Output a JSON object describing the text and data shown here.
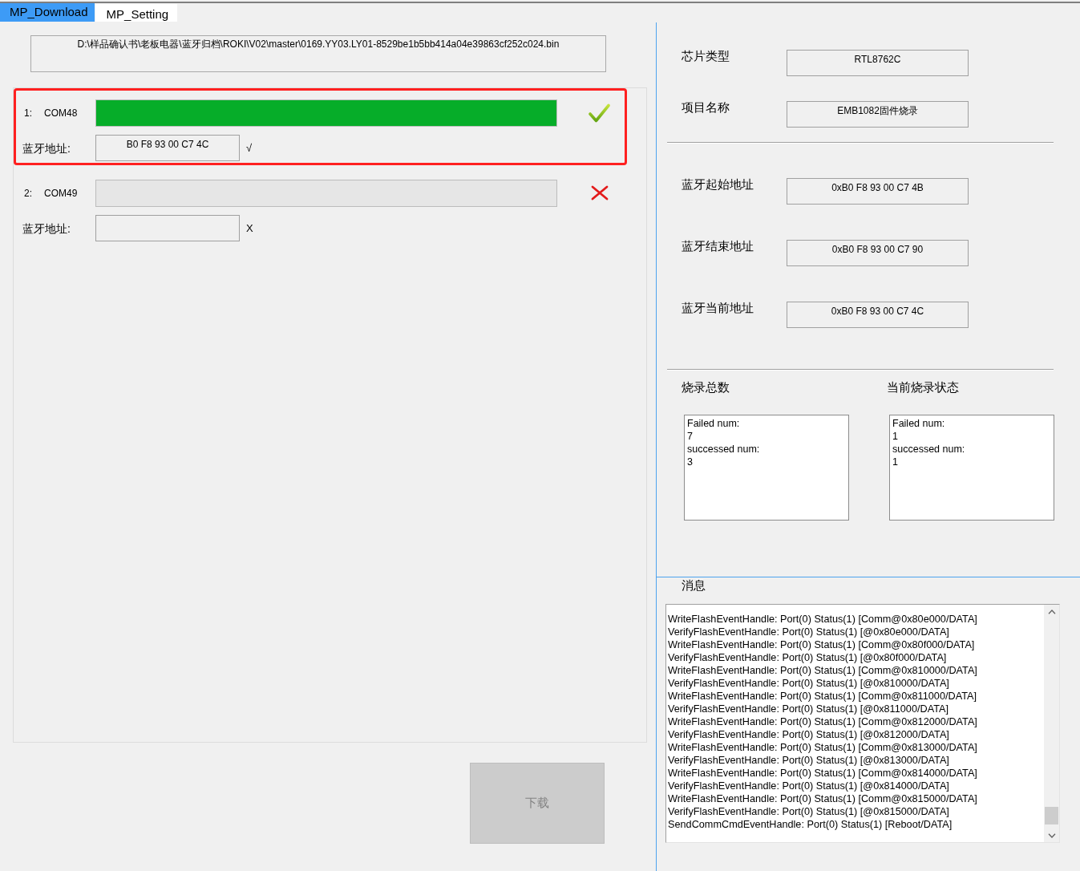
{
  "tabs": [
    {
      "label": "MP_Download",
      "selected": true
    },
    {
      "label": "MP_Setting",
      "selected": false
    }
  ],
  "file_path": "D:\\样品确认书\\老板电器\\蓝牙归档\\ROKI\\V02\\master\\0169.YY03.LY01-8529be1b5bb414a04e39863cf252c024.bin",
  "ports": [
    {
      "index": "1:",
      "name": "COM48",
      "level": 1,
      "passed": true,
      "highlighted": true,
      "address_label": "蓝牙地址:",
      "address": "B0 F8 93 00 C7 4C",
      "address_mark": "√"
    },
    {
      "index": "2:",
      "name": "COM49",
      "level": 0,
      "passed": false,
      "highlighted": false,
      "address_label": "蓝牙地址:",
      "address_mark": "X"
    }
  ],
  "download_button": {
    "label": "下载",
    "disabled": true
  },
  "chip_info": [
    {
      "label": "芯片类型",
      "value": "RTL8762C"
    },
    {
      "label": "项目名称",
      "value": "EMB1082固件烧录"
    }
  ],
  "bt_addresses": [
    {
      "label": "蓝牙起始地址",
      "value": "0xB0 F8 93 00 C7 4B"
    },
    {
      "label": "蓝牙结束地址",
      "value": "0xB0 F8 93 00 C7 90"
    },
    {
      "label": "蓝牙当前地址",
      "value": "0xB0 F8 93 00 C7 4C"
    }
  ],
  "counters": [
    {
      "title": "烧录总数",
      "lines": [
        "Failed num:",
        "7",
        "successed num:",
        "3"
      ]
    },
    {
      "title": "当前烧录状态",
      "lines": [
        "Failed num:",
        "1",
        "successed num:",
        "1"
      ]
    }
  ],
  "messages": {
    "title": "消息",
    "lines": [
      "WriteFlashEventHandle: Port(0) Status(1) [Comm@0x80e000/DATA]",
      "VerifyFlashEventHandle: Port(0) Status(1) [@0x80e000/DATA]",
      "WriteFlashEventHandle: Port(0) Status(1) [Comm@0x80f000/DATA]",
      "VerifyFlashEventHandle: Port(0) Status(1) [@0x80f000/DATA]",
      "WriteFlashEventHandle: Port(0) Status(1) [Comm@0x810000/DATA]",
      "VerifyFlashEventHandle: Port(0) Status(1) [@0x810000/DATA]",
      "WriteFlashEventHandle: Port(0) Status(1) [Comm@0x811000/DATA]",
      "VerifyFlashEventHandle: Port(0) Status(1) [@0x811000/DATA]",
      "WriteFlashEventHandle: Port(0) Status(1) [Comm@0x812000/DATA]",
      "VerifyFlashEventHandle: Port(0) Status(1) [@0x812000/DATA]",
      "WriteFlashEventHandle: Port(0) Status(1) [Comm@0x813000/DATA]",
      "VerifyFlashEventHandle: Port(0) Status(1) [@0x813000/DATA]",
      "WriteFlashEventHandle: Port(0) Status(1) [Comm@0x814000/DATA]",
      "VerifyFlashEventHandle: Port(0) Status(1) [@0x814000/DATA]",
      "WriteFlashEventHandle: Port(0) Status(1) [Comm@0x815000/DATA]",
      "VerifyFlashEventHandle: Port(0) Status(1) [@0x815000/DATA]",
      "SendCommCmdEventHandle: Port(0) Status(1) [Reboot/DATA]"
    ]
  }
}
